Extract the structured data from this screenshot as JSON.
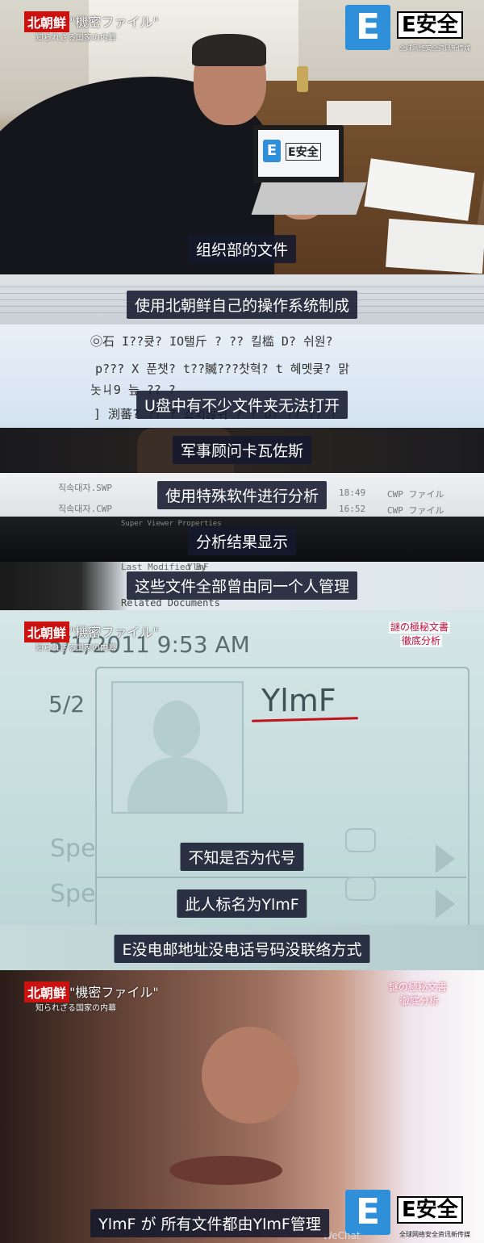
{
  "header": {
    "channel_tag": "北朝鲜",
    "program_tag": "\"機密ファイル\"",
    "program_subtitle": "知られざる国家の内幕",
    "right_tag_line1": "謎の極秘文書",
    "right_tag_line2": "徹底分析"
  },
  "logo": {
    "letter": "E",
    "name": "E安全",
    "tagline": "全球网络安全资讯新传媒"
  },
  "laptop_screen": {
    "letter": "E",
    "name": "E安全"
  },
  "subtitles": [
    "组织部的文件",
    "使用北朝鲜自己的操作系统制成",
    "U盘中有不少文件夹无法打开",
    "军事顾问卡瓦佐斯",
    "使用特殊软件进行分析",
    "分析结果显示",
    "这些文件全部曾由同一个人管理",
    "不知是否为代号",
    "此人标名为YlmF",
    "E没电邮地址没电话号码没联络方式",
    "YlmF が 所有文件都由YlmF管理"
  ],
  "garbled_lines": [
    "㉧石   I??큣?   IO탤斤   ?     ??   킬槛 D?      쉬원?",
    "p???   X 푼챗?   t??贓???찻혁?        t 혜멧쿶?   맑",
    "놋ㄐ9 늪 ??  ?                                      ",
    "] 渕蕃?   ??  ?  쇼외않쉬  ?   ?   D?    ??  ??  ?"
  ],
  "file_rows": [
    {
      "name": "직속대자.SWP",
      "time": "18:49",
      "type": "CWP ファイル"
    },
    {
      "name": "직속대자.CWP",
      "time": "16:52",
      "type": "CWP ファイル"
    }
  ],
  "file_footer": "Super Viewer Properties",
  "props": {
    "last_modified_by": "Last Modified By",
    "last_modified_value": "YlmF",
    "related": "Related Documents"
  },
  "profile": {
    "date_full": "5/1/2011 9:53 AM",
    "date_short": "5/2",
    "name": "YlmF",
    "row_label": "Spe"
  },
  "watermark": "WeChat"
}
